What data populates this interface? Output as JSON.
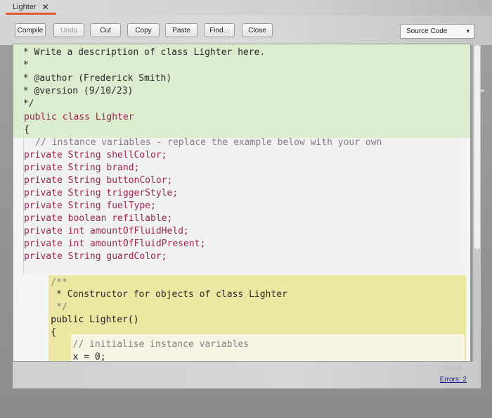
{
  "tab": {
    "title": "Lighter",
    "close": "✕"
  },
  "toolbar": {
    "compile": "Compile",
    "undo": "Undo",
    "cut": "Cut",
    "copy": "Copy",
    "paste": "Paste",
    "find": "Find...",
    "close": "Close"
  },
  "view_select": {
    "value": "Source Code",
    "chevron": "▾"
  },
  "code_lines": [
    " * Write a description of class Lighter here.",
    " *",
    " * @author (Frederick Smith)",
    " * @version (9/10/23)",
    " */",
    "public class Lighter",
    "{",
    "    // instance variables - replace the example below with your own",
    "private String shellColor;",
    "private String brand;",
    "private String buttonColor;",
    "private String triggerStyle;",
    "private String fuelType;",
    "private boolean refillable;",
    "private int amountOfFluidHeld;",
    "private int amountOfFluidPresent;",
    "private String guardColor;",
    "",
    "    /**",
    "     * Constructor for objects of class Lighter",
    "     */",
    "    public Lighter()",
    "    {",
    "        // initialise instance variables",
    "        x = 0;"
  ],
  "status": {
    "saved": "saved",
    "errors": "Errors: 2"
  },
  "grip": "⇹"
}
